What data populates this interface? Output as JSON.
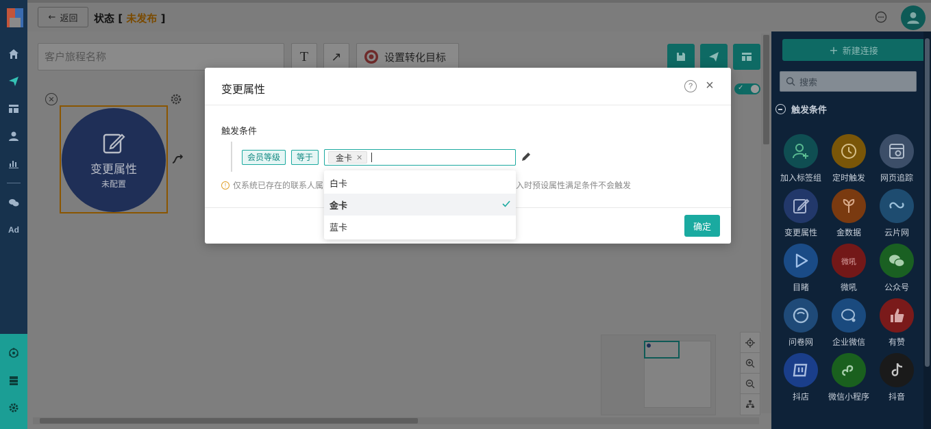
{
  "header": {
    "back_label": "返回",
    "title_prefix": "状态",
    "bracket_open": "[",
    "status": "未发布",
    "bracket_close": "]"
  },
  "toolbar": {
    "name_placeholder": "客户旅程名称",
    "goal_label": "设置转化目标"
  },
  "node": {
    "title": "变更属性",
    "subtitle": "未配置"
  },
  "panel": {
    "new_connection_label": "新建连接",
    "search_placeholder": "搜索",
    "section_title": "触发条件",
    "items": [
      {
        "label": "加入标签组",
        "color": "#0f4e52"
      },
      {
        "label": "定时触发",
        "color": "#7a5608"
      },
      {
        "label": "网页追踪",
        "color": "#3c4e68"
      },
      {
        "label": "变更属性",
        "color": "#22386a"
      },
      {
        "label": "金数据",
        "color": "#7a3a10"
      },
      {
        "label": "云片网",
        "color": "#1e4c70"
      },
      {
        "label": "目睹",
        "color": "#1a4b86"
      },
      {
        "label": "微吼",
        "color": "#731818"
      },
      {
        "label": "公众号",
        "color": "#1a6022"
      },
      {
        "label": "问卷网",
        "color": "#1f4a78"
      },
      {
        "label": "企业微信",
        "color": "#1a4a7e"
      },
      {
        "label": "有赞",
        "color": "#7a1a1a"
      },
      {
        "label": "抖店",
        "color": "#1a3e8a"
      },
      {
        "label": "微信小程序",
        "color": "#1a601e"
      },
      {
        "label": "抖音",
        "color": "#1a1a1a"
      }
    ]
  },
  "modal": {
    "title": "变更属性",
    "field_label": "触发条件",
    "condition_field": "会员等级",
    "operator": "等于",
    "selected_value": "金卡",
    "note_start": "仅系统已存在的联系人属",
    "note_end": "入时预设属性满足条件不会触发",
    "confirm_label": "确定"
  },
  "dropdown": {
    "options": [
      "白卡",
      "金卡",
      "蓝卡"
    ],
    "selected": "金卡"
  },
  "colors": {
    "primary": "#1aaaa0",
    "rail": "#17324d",
    "node": "#1f2f57"
  }
}
